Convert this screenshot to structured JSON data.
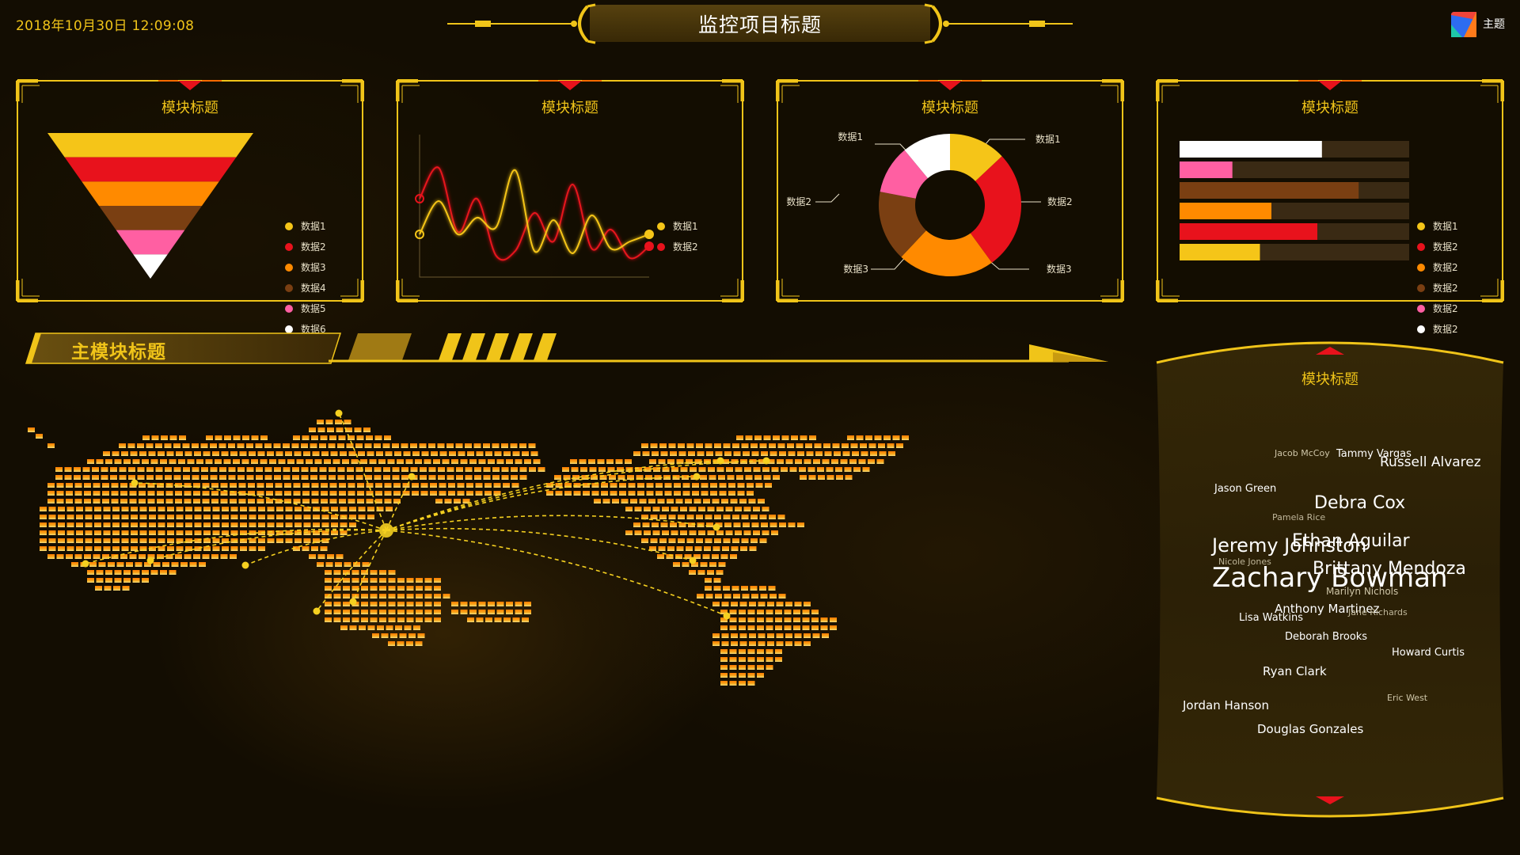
{
  "header": {
    "datetime": "2018年10月30日   12:09:08",
    "title": "监控项目标题",
    "theme_label": "主题",
    "theme_icon": "theme-logo-icon"
  },
  "colors": {
    "gold": "#f0c419",
    "red": "#e8121c",
    "orange": "#ff8a00",
    "brown": "#7a3f12",
    "pink": "#ff5fa2",
    "white": "#ffffff",
    "background": "#130d02"
  },
  "panels": [
    {
      "title": "模块标题",
      "legend": [
        {
          "label": "数据1",
          "color": "#f5c518"
        },
        {
          "label": "数据2",
          "color": "#e8121c"
        },
        {
          "label": "数据3",
          "color": "#ff8a00"
        },
        {
          "label": "数据4",
          "color": "#7a3f12"
        },
        {
          "label": "数据5",
          "color": "#ff5fa2"
        },
        {
          "label": "数据6",
          "color": "#ffffff"
        }
      ]
    },
    {
      "title": "模块标题",
      "legend": [
        {
          "label": "数据1",
          "color": "#f5c518"
        },
        {
          "label": "数据2",
          "color": "#e8121c"
        }
      ]
    },
    {
      "title": "模块标题",
      "donut_labels": {
        "left_top": "数据1",
        "left_mid": "数据2",
        "left_bottom": "数据3",
        "right_top": "数据1",
        "right_mid": "数据2",
        "right_bottom": "数据3"
      }
    },
    {
      "title": "模块标题",
      "legend": [
        {
          "label": "数据1",
          "color": "#f5c518"
        },
        {
          "label": "数据2",
          "color": "#e8121c"
        },
        {
          "label": "数据2",
          "color": "#ff8a00"
        },
        {
          "label": "数据2",
          "color": "#7a3f12"
        },
        {
          "label": "数据2",
          "color": "#ff5fa2"
        },
        {
          "label": "数据2",
          "color": "#ffffff"
        }
      ]
    }
  ],
  "chart_data": [
    {
      "type": "funnel",
      "series": [
        {
          "name": "数据1",
          "color": "#f5c518"
        },
        {
          "name": "数据2",
          "color": "#e8121c"
        },
        {
          "name": "数据3",
          "color": "#ff8a00"
        },
        {
          "name": "数据4",
          "color": "#7a3f12"
        },
        {
          "name": "数据5",
          "color": "#ff5fa2"
        },
        {
          "name": "数据6",
          "color": "#ffffff"
        }
      ]
    },
    {
      "type": "line",
      "smooth": true,
      "x": [
        0,
        1,
        2,
        3,
        4,
        5,
        6,
        7,
        8,
        9,
        10,
        11,
        12
      ],
      "series": [
        {
          "name": "数据1",
          "color": "#f5c518",
          "values": [
            18,
            32,
            18,
            25,
            21,
            45,
            11,
            24,
            10,
            26,
            12,
            15,
            18
          ]
        },
        {
          "name": "数据2",
          "color": "#e8121c",
          "values": [
            33,
            46,
            19,
            33,
            9,
            11,
            27,
            15,
            39,
            12,
            20,
            8,
            13
          ]
        }
      ]
    },
    {
      "type": "pie",
      "donut": true,
      "slices": [
        {
          "name": "数据1",
          "value": 13,
          "color": "#f5c518"
        },
        {
          "name": "数据2",
          "value": 27,
          "color": "#e8121c"
        },
        {
          "name": "数据3",
          "value": 22,
          "color": "#ff8a00"
        },
        {
          "name": "数据4",
          "value": 16,
          "color": "#7a3f12"
        },
        {
          "name": "数据5",
          "value": 11,
          "color": "#ff5fa2"
        },
        {
          "name": "数据6",
          "value": 11,
          "color": "#ffffff"
        }
      ]
    },
    {
      "type": "bar",
      "orientation": "horizontal",
      "max": 100,
      "values": [
        62,
        23,
        78,
        40,
        60,
        35
      ],
      "colors": [
        "#ffffff",
        "#ff5fa2",
        "#7a3f12",
        "#ff8a00",
        "#e8121c",
        "#f5c518"
      ]
    }
  ],
  "main": {
    "title": "主模块标题"
  },
  "cloud": {
    "title": "模块标题",
    "names": [
      {
        "text": "Jacob McCoy",
        "size": 11,
        "color": "#cfc6a8"
      },
      {
        "text": "Tammy Vargas",
        "size": 13,
        "color": "#ffffff"
      },
      {
        "text": "Russell Alvarez",
        "size": 17,
        "color": "#ffffff"
      },
      {
        "text": "Jason Green",
        "size": 13,
        "color": "#ffffff"
      },
      {
        "text": "Debra Cox",
        "size": 22,
        "color": "#ffffff"
      },
      {
        "text": "Pamela Rice",
        "size": 11,
        "color": "#bfb69a"
      },
      {
        "text": "Jeremy Johnston",
        "size": 24,
        "color": "#ffffff"
      },
      {
        "text": "Ethan Aguilar",
        "size": 22,
        "color": "#ffffff"
      },
      {
        "text": "Nicole Jones",
        "size": 11,
        "color": "#bfb69a"
      },
      {
        "text": "Brittany Mendoza",
        "size": 22,
        "color": "#ffffff"
      },
      {
        "text": "Zachary Bowman",
        "size": 34,
        "color": "#ffffff"
      },
      {
        "text": "Marilyn Nichols",
        "size": 12,
        "color": "#cfc6a8"
      },
      {
        "text": "Anthony Martinez",
        "size": 15,
        "color": "#ffffff"
      },
      {
        "text": "Lisa Watkins",
        "size": 13,
        "color": "#ffffff"
      },
      {
        "text": "Jane Richards",
        "size": 11,
        "color": "#bfb69a"
      },
      {
        "text": "Deborah Brooks",
        "size": 13,
        "color": "#ffffff"
      },
      {
        "text": "Howard Curtis",
        "size": 13,
        "color": "#ffffff"
      },
      {
        "text": "Ryan Clark",
        "size": 15,
        "color": "#ffffff"
      },
      {
        "text": "Eric West",
        "size": 11,
        "color": "#cfc6a8"
      },
      {
        "text": "Jordan Hanson",
        "size": 15,
        "color": "#ffffff"
      },
      {
        "text": "Douglas Gonzales",
        "size": 15,
        "color": "#ffffff"
      }
    ]
  }
}
